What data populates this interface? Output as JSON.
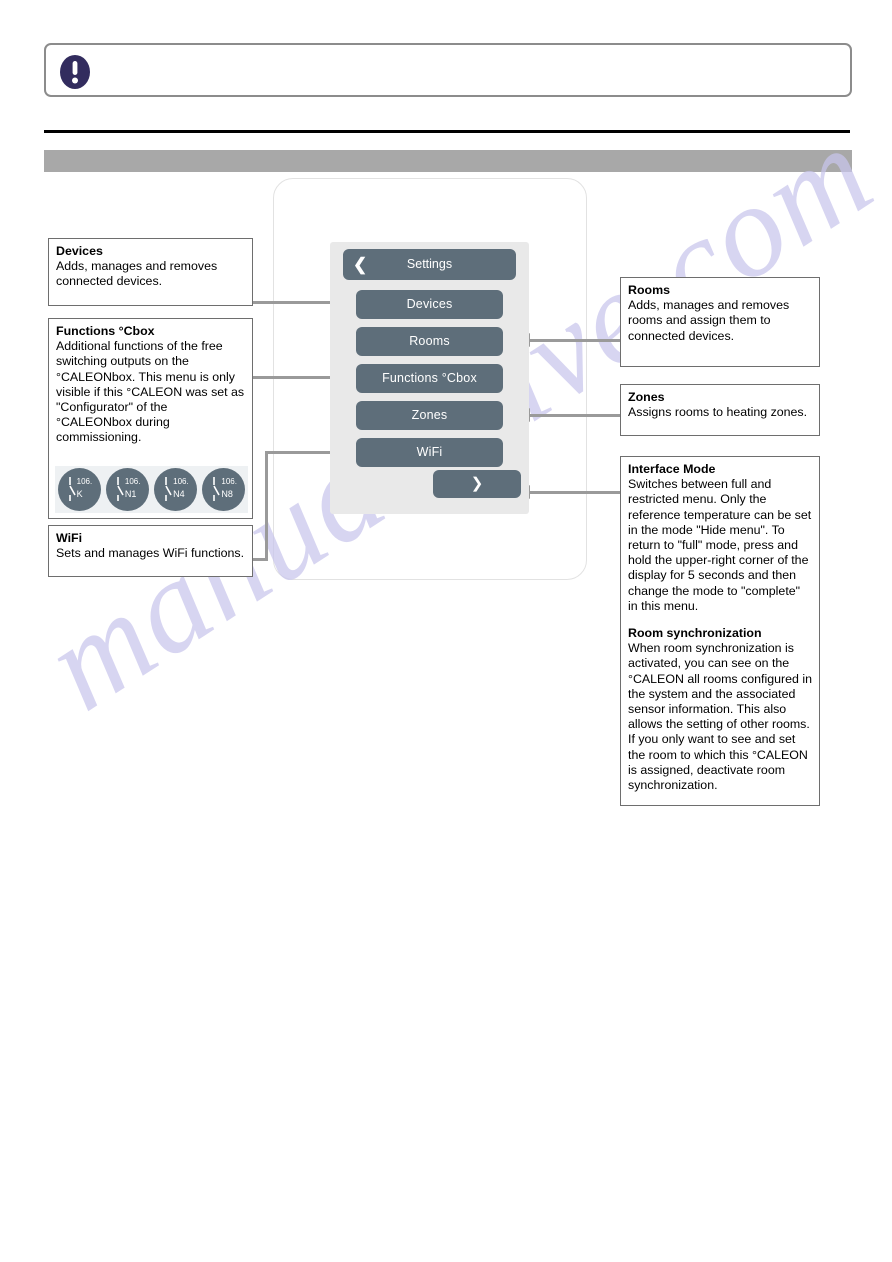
{
  "note": {
    "icon": "exclamation-circle-icon"
  },
  "device": {
    "header": {
      "title": "Settings",
      "back_icon": "chevron-left-icon"
    },
    "menu_items": [
      {
        "label": "Devices"
      },
      {
        "label": "Rooms"
      },
      {
        "label": "Functions °Cbox"
      },
      {
        "label": "Zones"
      },
      {
        "label": "WiFi"
      }
    ],
    "scroll_down": {
      "icon": "chevron-down-icon"
    }
  },
  "callouts": {
    "devices": {
      "title": "Devices",
      "body": "Adds, manages and removes connected devices."
    },
    "functions": {
      "title": "Functions °Cbox",
      "body": " Additional functions of the free switching outputs on the °CALEONbox. This menu is only visible if this °CALEON was set as \"Configurator\" of the °CALEONbox during commissioning.",
      "badges": [
        {
          "number": "106.",
          "id": "K"
        },
        {
          "number": "106.",
          "id": "N1"
        },
        {
          "number": "106.",
          "id": "N4"
        },
        {
          "number": "106.",
          "id": "N8"
        }
      ]
    },
    "wifi": {
      "title": "WiFi",
      "body": "Sets and manages WiFi functions."
    },
    "rooms": {
      "title": "Rooms",
      "body": "Adds, manages and removes rooms and assign them to connected devices."
    },
    "zones": {
      "title": "Zones",
      "body": "Assigns rooms to heating zones."
    },
    "interface_mode": {
      "title": "Interface Mode",
      "body": "Switches between full and restricted menu. Only the reference temperature can be set in the mode \"Hide menu\". To return to \"full\" mode, press and hold the upper-right corner of the display for 5 seconds and then change the mode to \"complete\" in this menu.",
      "title2": "Room synchronization",
      "body2": " When room synchronization is activated, you can see on the °CALEON all rooms configured in the system and the associated sensor information. This also allows the setting of other rooms. If you only want to see and set the room to which this °CALEON is assigned, deactivate room synchronization."
    }
  },
  "watermark": {
    "text": "manualshive.com"
  },
  "colors": {
    "button": "#5e6e7a",
    "screen_bg": "#e9e9e9",
    "section_bar": "#a8a8a8",
    "connector": "#9a9a9a",
    "note_icon": "#322c5e"
  }
}
